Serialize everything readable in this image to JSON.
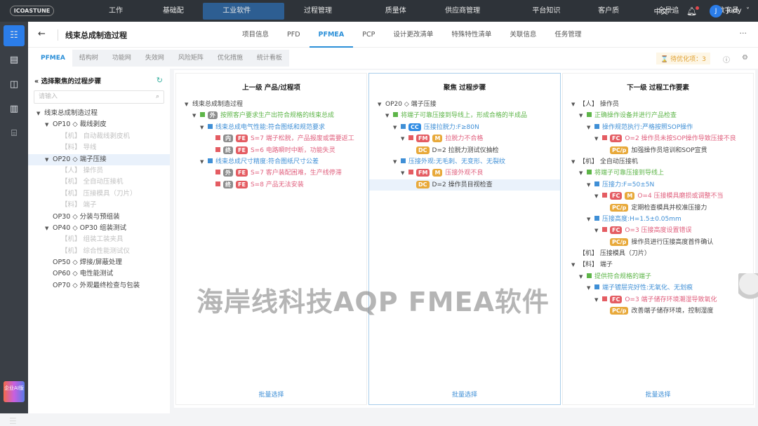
{
  "topbar": {
    "logo": "ICOASTUNE",
    "nav": [
      "工作台",
      "基础配置",
      "工业软件",
      "过程管理",
      "质量体系",
      "供应商管理",
      "平台知识库",
      "客户质量",
      "全景追溯",
      "数字员工"
    ],
    "nav_dropdown": [
      false,
      false,
      true,
      true,
      false,
      true,
      false,
      false,
      false,
      false
    ],
    "active": 2,
    "lang": "中文",
    "user_initial": "J",
    "user": "Judy"
  },
  "rail": {
    "ai_badge": "企业AI版"
  },
  "header": {
    "title": "线束总成制造过程",
    "tabs": [
      "项目信息",
      "PFD",
      "PFMEA",
      "PCP",
      "设计更改清单",
      "特殊特性清单",
      "关联信息",
      "任务管理"
    ],
    "active": 2,
    "more": "···"
  },
  "subtabs": {
    "items": [
      "PFMEA",
      "结构树",
      "功能网",
      "失效网",
      "风险矩阵",
      "优化措施",
      "统计看板"
    ],
    "active": 0,
    "pending": "待优化项：3"
  },
  "left": {
    "title": "选择聚焦的过程步骤",
    "search_placeholder": "请输入",
    "tree": [
      {
        "l": 0,
        "c": true,
        "t": "线束总成制造过程"
      },
      {
        "l": 1,
        "c": true,
        "t": "OP10 ◇ 裁线剥皮"
      },
      {
        "l": 2,
        "d": true,
        "t": "【机】 自动裁线剥皮机"
      },
      {
        "l": 2,
        "d": true,
        "t": "【料】 导线"
      },
      {
        "l": 1,
        "c": true,
        "s": true,
        "t": "OP20 ◇ 端子压接"
      },
      {
        "l": 2,
        "d": true,
        "t": "【人】 操作员"
      },
      {
        "l": 2,
        "d": true,
        "t": "【机】 全自动压接机"
      },
      {
        "l": 2,
        "d": true,
        "t": "【机】 压接模具（刀片）"
      },
      {
        "l": 2,
        "d": true,
        "t": "【料】 端子"
      },
      {
        "l": 1,
        "t": "OP30 ◇ 分装与预组装"
      },
      {
        "l": 1,
        "c": true,
        "t": "OP40 ◇ OP30 组装测试"
      },
      {
        "l": 2,
        "d": true,
        "t": "【机】 组装工装夹具"
      },
      {
        "l": 2,
        "d": true,
        "t": "【机】 综合性能测试仪"
      },
      {
        "l": 1,
        "t": "OP50 ◇ 焊接/屏蔽处理"
      },
      {
        "l": 1,
        "t": "OP60 ◇ 电性能测试"
      },
      {
        "l": 1,
        "t": "OP70 ◇ 外观最终检查与包装"
      }
    ]
  },
  "columns": [
    {
      "title": "上一级 产品/过程项",
      "batch": "批量选择",
      "rows": [
        {
          "l": 0,
          "c": true,
          "color": "dark",
          "t": "线束总成制造过程"
        },
        {
          "l": 1,
          "c": true,
          "sq": "#5db548",
          "tags": [
            [
              "外",
              "gray"
            ]
          ],
          "color": "green",
          "t": "按照客户要求生产出符合规格的线束总成"
        },
        {
          "l": 2,
          "c": true,
          "sq": "#3f8fd6",
          "color": "blue",
          "t": "线束总成电气性能:符合图纸和规范要求"
        },
        {
          "l": 3,
          "sq": "#e45c62",
          "tags": [
            [
              "内",
              "gray"
            ],
            [
              "FE",
              "red"
            ]
          ],
          "color": "red",
          "t": "S=7  端子松脱，产品报废或需要返工"
        },
        {
          "l": 3,
          "sq": "#e45c62",
          "tags": [
            [
              "终",
              "gray"
            ],
            [
              "FE",
              "red"
            ]
          ],
          "color": "red",
          "t": "S=6 电路瞬时中断，功能失灵"
        },
        {
          "l": 2,
          "c": true,
          "sq": "#3f8fd6",
          "color": "blue",
          "t": "线束总成尺寸精度:符合图纸尺寸公差"
        },
        {
          "l": 3,
          "sq": "#e45c62",
          "tags": [
            [
              "外",
              "gray"
            ],
            [
              "FE",
              "red"
            ]
          ],
          "color": "red",
          "t": "S=7  客户装配困难，生产线停滞"
        },
        {
          "l": 3,
          "sq": "#e45c62",
          "tags": [
            [
              "终",
              "gray"
            ],
            [
              "FE",
              "red"
            ]
          ],
          "color": "red",
          "t": "S=8  产品无法安装"
        }
      ]
    },
    {
      "title": "聚焦 过程步骤",
      "batch": "批量选择",
      "rows": [
        {
          "l": 0,
          "c": true,
          "color": "dark",
          "t": "OP20 ◇ 端子压接"
        },
        {
          "l": 1,
          "c": true,
          "sq": "#5db548",
          "color": "green",
          "t": "将端子可靠压接到导线上，形成合格的半成品"
        },
        {
          "l": 2,
          "c": true,
          "sq": "#3f8fd6",
          "tags": [
            [
              "CC",
              "blue"
            ]
          ],
          "color": "blue",
          "t": "压接拉脱力:F≥80N"
        },
        {
          "l": 3,
          "c": true,
          "sq": "#e45c62",
          "tags": [
            [
              "FM",
              "red"
            ],
            [
              "M",
              "orange"
            ]
          ],
          "color": "red",
          "t": "拉脱力不合格"
        },
        {
          "l": 4,
          "tags": [
            [
              "DC",
              "orange"
            ]
          ],
          "color": "dark",
          "t": "D=2  拉脱力测试仪抽检"
        },
        {
          "l": 2,
          "c": true,
          "sq": "#3f8fd6",
          "color": "blue",
          "t": "压接外观:无毛刺、无变形、无裂纹"
        },
        {
          "l": 3,
          "c": true,
          "sq": "#e45c62",
          "tags": [
            [
              "FM",
              "red"
            ],
            [
              "M",
              "orange"
            ]
          ],
          "color": "red",
          "t": "压接外观不良"
        },
        {
          "l": 4,
          "hl": true,
          "tags": [
            [
              "DC",
              "orange"
            ]
          ],
          "color": "dark",
          "t": "D=2  操作员目视检查"
        }
      ]
    },
    {
      "title": "下一级 过程工作要素",
      "batch": "批量选择",
      "rows": [
        {
          "l": 0,
          "c": true,
          "color": "dark",
          "t": "【人】 操作员"
        },
        {
          "l": 1,
          "c": true,
          "sq": "#5db548",
          "color": "green",
          "t": "正确操作设备并进行产品检查"
        },
        {
          "l": 2,
          "c": true,
          "sq": "#3f8fd6",
          "color": "blue",
          "t": "操作规范执行:严格按照SOP操作"
        },
        {
          "l": 3,
          "c": true,
          "sq": "#e45c62",
          "tags": [
            [
              "FC",
              "red"
            ]
          ],
          "color": "red",
          "t": "O=2 操作员未按SOP操作导致压接不良"
        },
        {
          "l": 4,
          "tags": [
            [
              "PC/p",
              "orange"
            ]
          ],
          "color": "dark",
          "t": "加强操作员培训和SOP宣贯"
        },
        {
          "l": 0,
          "c": true,
          "color": "dark",
          "t": "【机】 全自动压接机"
        },
        {
          "l": 1,
          "c": true,
          "sq": "#5db548",
          "color": "green",
          "t": "将端子可靠压接到导线上"
        },
        {
          "l": 2,
          "c": true,
          "sq": "#3f8fd6",
          "color": "blue",
          "t": "压接力:F=50±5N"
        },
        {
          "l": 3,
          "c": true,
          "sq": "#e45c62",
          "tags": [
            [
              "FC",
              "red"
            ],
            [
              "M",
              "orange"
            ]
          ],
          "color": "red",
          "t": "O=4 压接模具磨损或调整不当"
        },
        {
          "l": 4,
          "tags": [
            [
              "PC/p",
              "orange"
            ]
          ],
          "color": "dark",
          "t": "定期检查模具并校准压接力"
        },
        {
          "l": 2,
          "c": true,
          "sq": "#3f8fd6",
          "color": "blue",
          "t": "压接高度:H=1.5±0.05mm"
        },
        {
          "l": 3,
          "c": true,
          "sq": "#e45c62",
          "tags": [
            [
              "FC",
              "red"
            ]
          ],
          "color": "red",
          "t": "O=3 压接高度设置错误"
        },
        {
          "l": 4,
          "tags": [
            [
              "PC/p",
              "orange"
            ]
          ],
          "color": "dark",
          "t": "操作员进行压接高度首件确认"
        },
        {
          "l": 0,
          "color": "dark",
          "t": "【机】 压接模具（刀片）"
        },
        {
          "l": 0,
          "c": true,
          "color": "dark",
          "t": "【料】 端子"
        },
        {
          "l": 1,
          "c": true,
          "sq": "#5db548",
          "color": "green",
          "t": "提供符合规格的端子"
        },
        {
          "l": 2,
          "c": true,
          "sq": "#3f8fd6",
          "color": "blue",
          "t": "端子镀层完好性:无氧化、无划痕"
        },
        {
          "l": 3,
          "c": true,
          "sq": "#e45c62",
          "tags": [
            [
              "FC",
              "red"
            ]
          ],
          "color": "red",
          "t": "O=3 端子储存环境潮湿导致氧化"
        },
        {
          "l": 4,
          "tags": [
            [
              "PC/p",
              "orange"
            ]
          ],
          "color": "dark",
          "t": "改善端子储存环境，控制湿度"
        }
      ]
    }
  ],
  "watermark": "海岸线科技AQP FMEA软件"
}
